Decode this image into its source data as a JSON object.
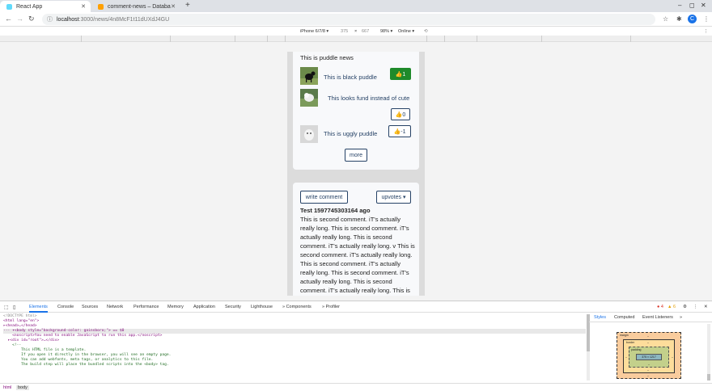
{
  "browser": {
    "tabs": [
      {
        "title": "React App",
        "active": true,
        "favicon_color": "#61dafb"
      },
      {
        "title": "comment-news – Databa",
        "active": false,
        "favicon_color": "#ffa000"
      }
    ],
    "new_tab": "+",
    "url_host": "localhost",
    "url_path": ":3000/news/4n8McF1t11dUXdJ4GU",
    "profile_initial": "C"
  },
  "device_toolbar": {
    "device": "iPhone 6/7/8 ▾",
    "width": "375",
    "times": "×",
    "height": "667",
    "zoom": "98% ▾",
    "network": "Online ▾"
  },
  "news": {
    "title": "This is puddle news",
    "items": [
      {
        "text": "This is black puddle",
        "vote": "👍1",
        "vote_style": "green"
      },
      {
        "text": "This looks fund instead of cute",
        "vote": "👍0",
        "vote_style": "outline"
      },
      {
        "text": "This is uggly puddle",
        "vote": "👍-1",
        "vote_style": "outline"
      }
    ],
    "more_label": "more"
  },
  "comments": {
    "write_label": "write comment",
    "sort_label": "upvotes ▾",
    "author_line": "Test  1597745303164 ago",
    "body": "This is second comment. iT's actually really long. This is second comment. iT's actually really long. This is second comment. iT's actually really long. v This is second comment. iT's actually really long. This is second comment. iT's actually really long. This is second comment. iT's actually really long. This is second comment. iT's actually really long. This is second comment. iT's"
  },
  "devtools": {
    "tabs": [
      "Elements",
      "Console",
      "Sources",
      "Network",
      "Performance",
      "Memory",
      "Application",
      "Security",
      "Lighthouse",
      "» Components",
      "» Profiler"
    ],
    "errors": "● 4",
    "warnings": "▲ 6",
    "code_lines": [
      "<!DOCTYPE html>",
      "<html lang=\"en\">",
      "▸<head>…</head>",
      "··· ▾<body style=\"background-color: gainsboro;\"> == $0",
      "    <noscript>You need to enable JavaScript to run this app.</noscript>",
      "  ▸<div id=\"root\">…</div>",
      "    <!--",
      "",
      "        This HTML file is a template.",
      "        If you open it directly in the browser, you will see an empty page.",
      "",
      "        You can add webfonts, meta tags, or analytics to this file.",
      "        The build step will place the bundled scripts into the <body> tag."
    ],
    "styles_tabs": [
      "Styles",
      "Computed",
      "Event Listeners",
      "»"
    ],
    "box_model": {
      "margin": "margin",
      "border": "border",
      "padding": "padding",
      "content": "375 × 1217",
      "dash": "–"
    },
    "breadcrumb": [
      "html",
      "body"
    ]
  }
}
